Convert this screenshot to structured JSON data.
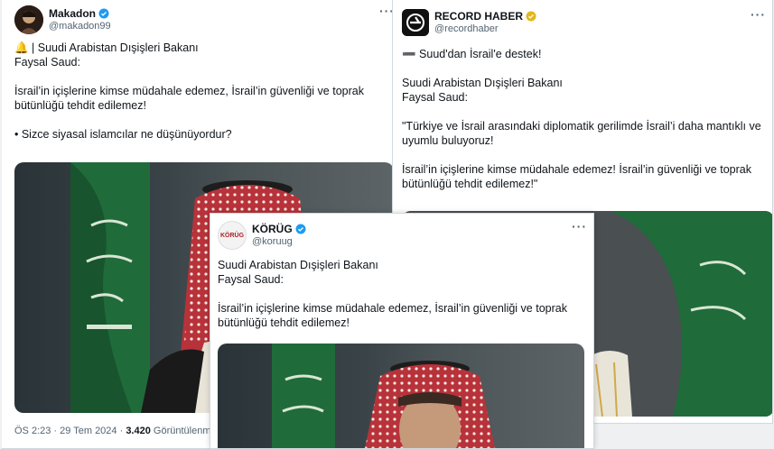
{
  "tweet1": {
    "name": "Makadon",
    "handle": "@makadon99",
    "line1": "🔔 | Suudi Arabistan Dışişleri Bakanı",
    "line2": "Faysal Saud:",
    "line3": "İsrail’in içişlerine kimse müdahale edemez, İsrail’in güvenliği ve toprak",
    "line4": "bütünlüğü tehdit edilemez!",
    "line5": "• Sizce siyasal islamcılar ne düşünüyordur?",
    "time": "ÖS 2:23 · 29 Tem 2024 · ",
    "views_count": "3.420",
    "views_label": " Görüntülenme",
    "more": "···"
  },
  "tweet2": {
    "name": "RECORD HABER",
    "handle": "@recordhaber",
    "line1": "➖ Suud'dan İsrail'e destek!",
    "line2": "Suudi Arabistan Dışişleri Bakanı",
    "line3": "Faysal Saud:",
    "line4": "\"Türkiye ve İsrail arasındaki diplomatik gerilimde İsrail’i daha mantıklı ve",
    "line5": "uyumlu buluyoruz!",
    "line6": "İsrail’in içişlerine kimse müdahale edemez! İsrail’in güvenliği ve toprak",
    "line7": "bütünlüğü tehdit edilemez!\"",
    "more": "···"
  },
  "tweet3": {
    "name": "KÖRÜG",
    "handle": "@koruug",
    "avatar_text": "KÖRÜG",
    "line1": "Suudi Arabistan Dışişleri Bakanı",
    "line2": "Faysal Saud:",
    "line3": "İsrail’in içişlerine kimse müdahale edemez, İsrail’in güvenliği ve toprak",
    "line4": "bütünlüğü tehdit edilemez!",
    "more": "···"
  },
  "colors": {
    "verified_blue": "#1d9bf0",
    "verified_gold": "#e2b719",
    "flag_green": "#1f6b3a",
    "keffiyeh_red": "#b8323a"
  }
}
